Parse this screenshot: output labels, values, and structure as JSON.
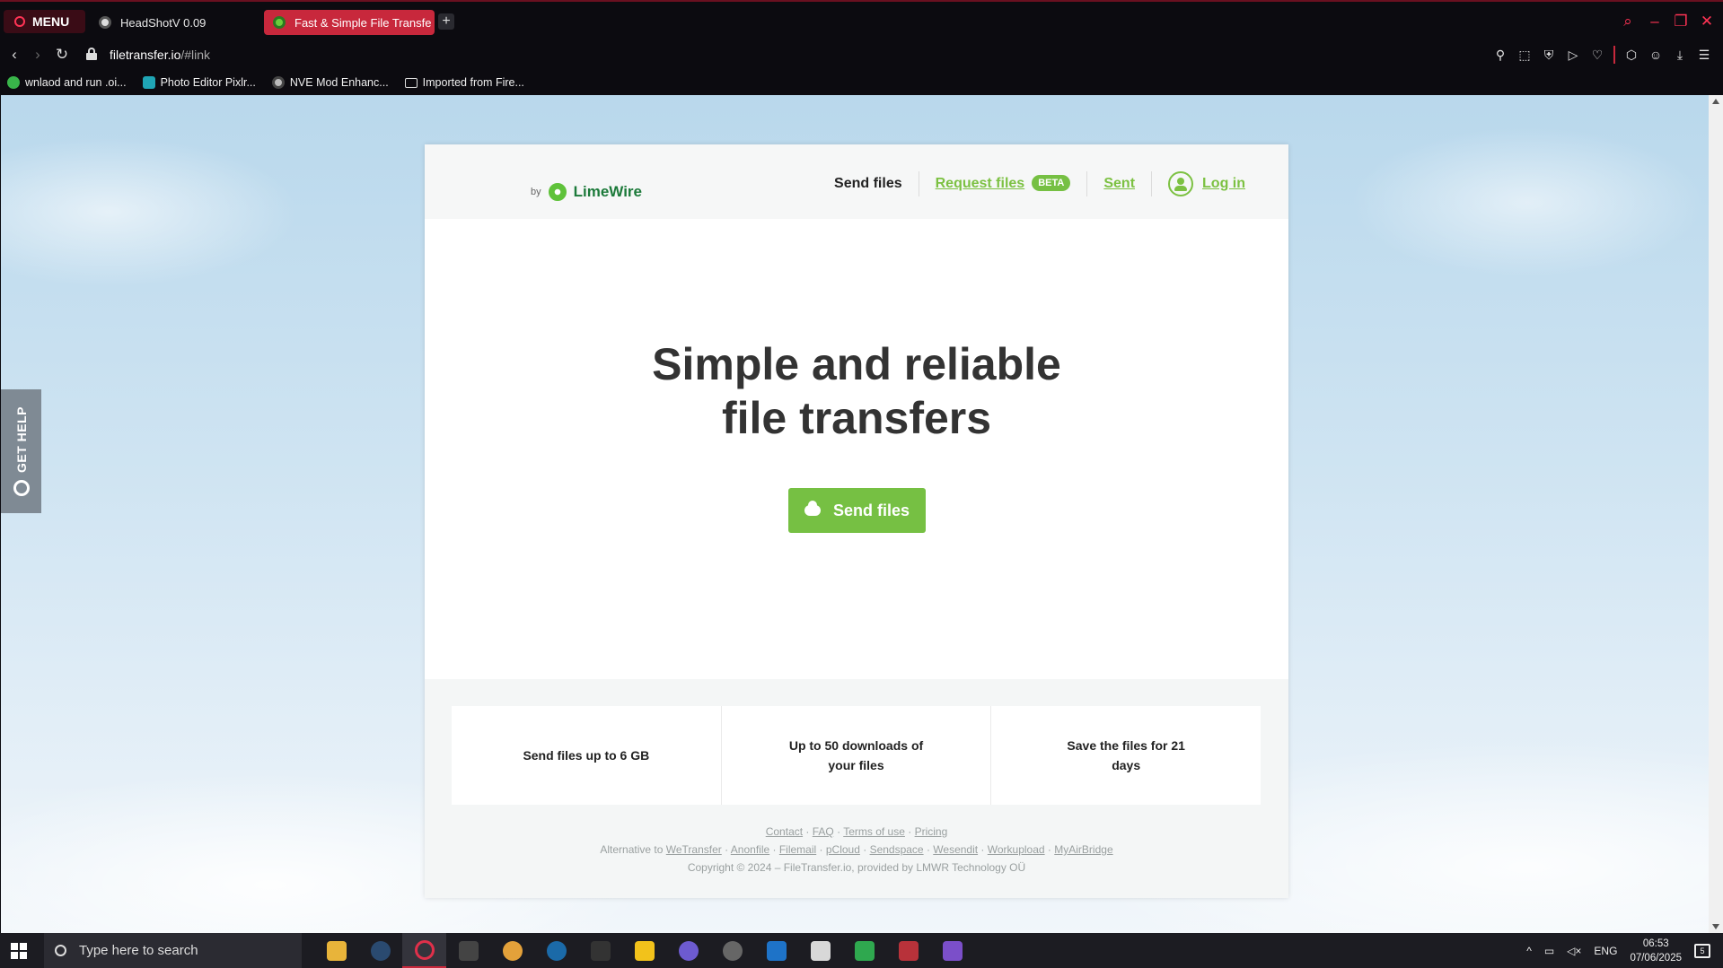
{
  "browser": {
    "menu_label": "MENU",
    "tabs": [
      {
        "title": "HeadShotV 0.09"
      },
      {
        "title": "Fast & Simple File Transfe"
      }
    ],
    "new_tab_label": "+",
    "url_host": "filetransfer.io",
    "url_path": "/#link",
    "bookmarks": [
      {
        "label": "wnlaod and run .oi..."
      },
      {
        "label": "Photo Editor Pixlr..."
      },
      {
        "label": "NVE Mod Enhanc..."
      },
      {
        "label": "Imported from Fire..."
      }
    ]
  },
  "page": {
    "get_help_label": "GET HELP",
    "logo_by": "by",
    "logo_name": "LimeWire",
    "nav": {
      "send_files": "Send files",
      "request_files": "Request files",
      "beta_badge": "BETA",
      "sent": "Sent",
      "login": "Log in"
    },
    "hero_line1": "Simple and reliable",
    "hero_line2": "file transfers",
    "cta_label": "Send files",
    "features": [
      {
        "text": "Send files up to 6 GB"
      },
      {
        "text": "Up to 50 downloads of your files"
      },
      {
        "text": "Save the files for 21 days"
      }
    ],
    "footer_links": [
      "Contact",
      "FAQ",
      "Terms of use",
      "Pricing"
    ],
    "alternative_prefix": "Alternative to",
    "alternatives": [
      "WeTransfer",
      "Anonfile",
      "Filemail",
      "pCloud",
      "Sendspace",
      "Wesendit",
      "Workupload",
      "MyAirBridge"
    ],
    "copyright": "Copyright © 2024 – FileTransfer.io, provided by LMWR Technology OÜ"
  },
  "taskbar": {
    "search_placeholder": "Type here to search",
    "language": "ENG",
    "time": "06:53",
    "date": "07/06/2025",
    "notification_count": "5"
  },
  "colors": {
    "accent_green": "#76c043",
    "opera_red": "#c8283c"
  }
}
